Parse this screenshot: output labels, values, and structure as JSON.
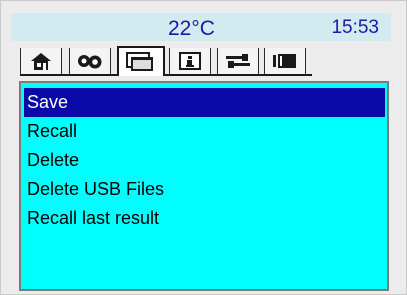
{
  "status": {
    "temperature": "22°C",
    "time": "15:53"
  },
  "tabs": [
    {
      "icon": "home-icon",
      "active": false
    },
    {
      "icon": "gears-icon",
      "active": false
    },
    {
      "icon": "file-stack-icon",
      "active": true
    },
    {
      "icon": "info-icon",
      "active": false
    },
    {
      "icon": "usb-connection-icon",
      "active": false
    },
    {
      "icon": "panel-icon",
      "active": false
    }
  ],
  "menu": {
    "items": [
      "Save",
      "Recall",
      "Delete",
      "Delete USB Files",
      "Recall last result"
    ],
    "selected": "Save"
  },
  "colors": {
    "panel": "#00ffff",
    "selection": "#0a0aa8",
    "status_text": "#1a1aa6",
    "status_bg": "#d2ebf0"
  }
}
